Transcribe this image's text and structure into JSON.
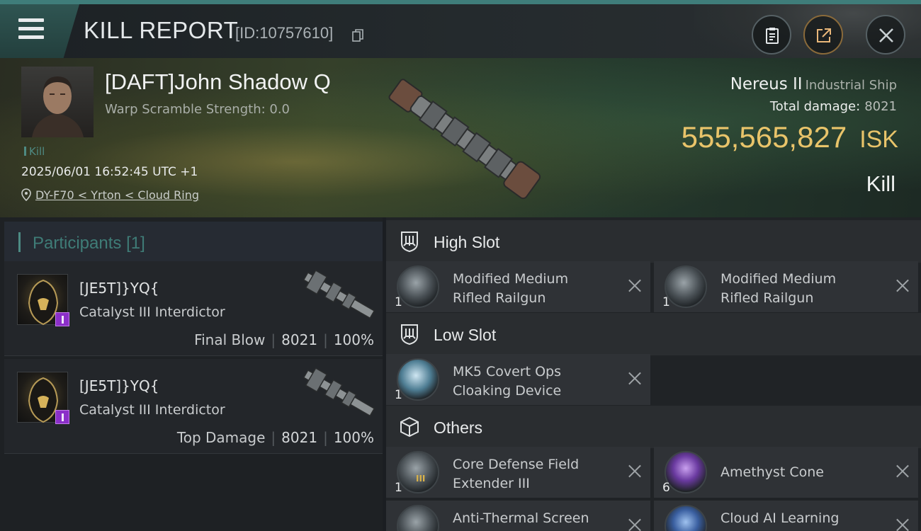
{
  "header": {
    "title": "KILL REPORT",
    "report_id": "[ID:10757610]",
    "icons": [
      "menu-icon",
      "copy-icon",
      "clipboard-icon",
      "share-icon",
      "close-icon"
    ]
  },
  "victim": {
    "name": "[DAFT]John Shadow Q",
    "warp_scramble": "Warp Scramble Strength: 0.0",
    "kill_tag": "Kill",
    "time": "2025/06/01 16:52:45 UTC +1",
    "location": "DY-F70 < Yrton < Cloud Ring",
    "ship_name": "Nereus II",
    "ship_class": "Industrial Ship",
    "total_damage_label": "Total damage:",
    "total_damage_value": "8021",
    "isk_value": "555,565,827",
    "isk_unit": "ISK",
    "result": "Kill"
  },
  "participants": {
    "header": "Participants",
    "count": "[1]",
    "items": [
      {
        "name": "[JE5T]}YQ{",
        "ship": "Catalyst III Interdictor",
        "label": "Final Blow",
        "damage": "8021",
        "percent": "100%"
      },
      {
        "name": "[JE5T]}YQ{",
        "ship": "Catalyst III Interdictor",
        "label": "Top Damage",
        "damage": "8021",
        "percent": "100%"
      }
    ]
  },
  "fitting": {
    "high_slot": {
      "label": "High Slot",
      "modules": [
        {
          "qty": "1",
          "name": "Modified Medium Rifled Railgun",
          "line1": "Modified Medium",
          "line2": "Rifled Railgun"
        },
        {
          "qty": "1",
          "name": "Modified Medium Rifled Railgun",
          "line1": "Modified Medium",
          "line2": "Rifled Railgun"
        }
      ]
    },
    "low_slot": {
      "label": "Low Slot",
      "modules": [
        {
          "qty": "1",
          "line1": "MK5 Covert Ops",
          "line2": "Cloaking Device"
        }
      ]
    },
    "others": {
      "label": "Others",
      "modules": [
        {
          "qty": "1",
          "line1": "Core Defense Field",
          "line2": "Extender III",
          "tier": "III"
        },
        {
          "qty": "6",
          "line1": "Amethyst Cone"
        },
        {
          "qty": "",
          "line1": "Anti-Thermal Screen"
        },
        {
          "qty": "",
          "line1": "Cloud AI Learning"
        }
      ]
    }
  }
}
